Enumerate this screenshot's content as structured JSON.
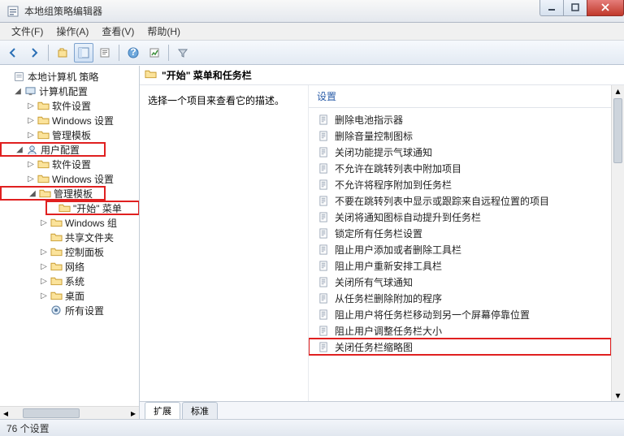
{
  "window": {
    "title": "本地组策略编辑器"
  },
  "menu": {
    "file": "文件(F)",
    "action": "操作(A)",
    "view": "查看(V)",
    "help": "帮助(H)"
  },
  "tree": {
    "root": "本地计算机 策略",
    "computer_config": "计算机配置",
    "cc_soft": "软件设置",
    "cc_win": "Windows 设置",
    "cc_tpl": "管理模板",
    "user_config": "用户配置",
    "uc_soft": "软件设置",
    "uc_win": "Windows 设置",
    "uc_tpl": "管理模板",
    "start_menu": "\"开始\" 菜单",
    "win_comp": "Windows 组",
    "shared": "共享文件夹",
    "ctrl_panel": "控制面板",
    "network": "网络",
    "system": "系统",
    "desktop": "桌面",
    "all_settings": "所有设置"
  },
  "right": {
    "crumb": "\"开始\" 菜单和任务栏",
    "desc": "选择一个项目来查看它的描述。",
    "header": "设置",
    "items": [
      "删除电池指示器",
      "删除音量控制图标",
      "关闭功能提示气球通知",
      "不允许在跳转列表中附加项目",
      "不允许将程序附加到任务栏",
      "不要在跳转列表中显示或跟踪来自远程位置的项目",
      "关闭将通知图标自动提升到任务栏",
      "锁定所有任务栏设置",
      "阻止用户添加或者删除工具栏",
      "阻止用户重新安排工具栏",
      "关闭所有气球通知",
      "从任务栏删除附加的程序",
      "阻止用户将任务栏移动到另一个屏幕停靠位置",
      "阻止用户调整任务栏大小",
      "关闭任务栏缩略图"
    ]
  },
  "tabs": {
    "extended": "扩展",
    "standard": "标准"
  },
  "status": "76 个设置"
}
